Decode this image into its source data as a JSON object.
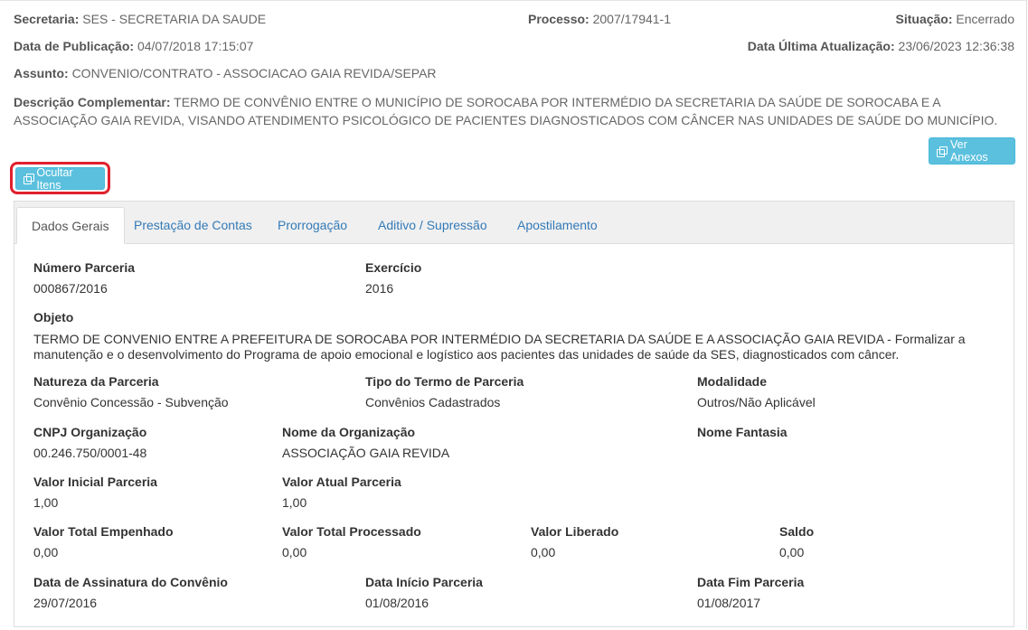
{
  "header": {
    "secretaria_label": "Secretaria:",
    "secretaria_value": "SES - SECRETARIA DA SAUDE",
    "processo_label": "Processo:",
    "processo_value": "2007/17941-1",
    "situacao_label": "Situação:",
    "situacao_value": "Encerrado",
    "publicacao_label": "Data de Publicação:",
    "publicacao_value": "04/07/2018 17:15:07",
    "atualizacao_label": "Data Última Atualização:",
    "atualizacao_value": "23/06/2023 12:36:38",
    "assunto_label": "Assunto:",
    "assunto_value": "CONVENIO/CONTRATO - ASSOCIACAO GAIA REVIDA/SEPAR",
    "descricao_label": "Descrição Complementar:",
    "descricao_value": "TERMO DE CONVÊNIO ENTRE O MUNICÍPIO DE SOROCABA POR INTERMÉDIO DA SECRETARIA DA SAÚDE DE SOROCABA E A ASSOCIAÇÃO GAIA REVIDA, VISANDO ATENDIMENTO PSICOLÓGICO DE PACIENTES DIAGNOSTICADOS COM CÂNCER NAS UNIDADES DE SAÚDE DO MUNICÍPIO."
  },
  "buttons": {
    "ver_anexos": "Ver Anexos",
    "ocultar_itens": "Ocultar Itens"
  },
  "tabs": [
    {
      "label": "Dados Gerais"
    },
    {
      "label": "Prestação de Contas"
    },
    {
      "label": "Prorrogação"
    },
    {
      "label": "Aditivo / Supressão"
    },
    {
      "label": "Apostilamento"
    }
  ],
  "fields": {
    "numero_parceria": {
      "label": "Número Parceria",
      "value": "000867/2016"
    },
    "exercicio": {
      "label": "Exercício",
      "value": "2016"
    },
    "objeto": {
      "label": "Objeto",
      "value": "TERMO DE CONVENIO ENTRE A PREFEITURA DE SOROCABA POR INTERMÉDIO DA SECRETARIA DA SAÚDE E A ASSOCIAÇÃO GAIA REVIDA - Formalizar a manutenção e o desenvolvimento do Programa de apoio emocional e logístico aos pacientes das unidades de saúde da SES, diagnosticados com câncer."
    },
    "natureza": {
      "label": "Natureza da Parceria",
      "value": "Convênio Concessão - Subvenção"
    },
    "tipo_termo": {
      "label": "Tipo do Termo de Parceria",
      "value": "Convênios Cadastrados"
    },
    "modalidade": {
      "label": "Modalidade",
      "value": "Outros/Não Aplicável"
    },
    "cnpj": {
      "label": "CNPJ Organização",
      "value": "00.246.750/0001-48"
    },
    "nome_org": {
      "label": "Nome da Organização",
      "value": "ASSOCIAÇÃO GAIA REVIDA"
    },
    "nome_fantasia": {
      "label": "Nome Fantasia",
      "value": ""
    },
    "valor_inicial": {
      "label": "Valor Inicial Parceria",
      "value": "1,00"
    },
    "valor_atual": {
      "label": "Valor Atual Parceria",
      "value": "1,00"
    },
    "valor_empenhado": {
      "label": "Valor Total Empenhado",
      "value": "0,00"
    },
    "valor_processado": {
      "label": "Valor Total Processado",
      "value": "0,00"
    },
    "valor_liberado": {
      "label": "Valor Liberado",
      "value": "0,00"
    },
    "saldo": {
      "label": "Saldo",
      "value": "0,00"
    },
    "data_assinatura": {
      "label": "Data de Assinatura do Convênio",
      "value": "29/07/2016"
    },
    "data_inicio": {
      "label": "Data Início Parceria",
      "value": "01/08/2016"
    },
    "data_fim": {
      "label": "Data Fim Parceria",
      "value": "01/08/2017"
    }
  },
  "colors": {
    "button_bg": "#5bc0de",
    "highlight": "#e0202e",
    "tab_link": "#337ab7"
  },
  "icons": {
    "button_icon": "copy-icon"
  }
}
